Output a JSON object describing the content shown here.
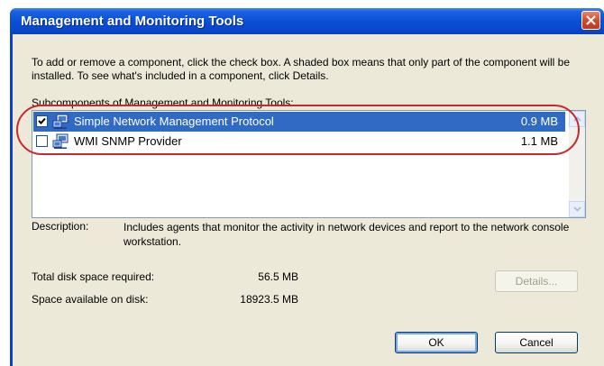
{
  "window": {
    "title": "Management and Monitoring Tools"
  },
  "intro_text": "To add or remove a component, click the check box. A shaded box means that only part of the component will be installed. To see what's included in a component, click Details.",
  "subcomponents_label": "Subcomponents of Management and Monitoring Tools:",
  "components": [
    {
      "name": "Simple Network Management Protocol",
      "size": "0.9 MB",
      "checked": true,
      "selected": true,
      "icon": "computer-network-icon"
    },
    {
      "name": "WMI SNMP Provider",
      "size": "1.1 MB",
      "checked": false,
      "selected": false,
      "icon": "computer-network-icon"
    }
  ],
  "description": {
    "label": "Description:",
    "text": "Includes agents that monitor the activity in network devices and report to the network console workstation."
  },
  "disk": {
    "required_label": "Total disk space required:",
    "required_value": "56.5 MB",
    "available_label": "Space available on disk:",
    "available_value": "18923.5 MB"
  },
  "buttons": {
    "details": "Details...",
    "ok": "OK",
    "cancel": "Cancel"
  },
  "colors": {
    "title_bar": "#0a4fd6",
    "selection": "#316ac5",
    "dialog_bg": "#ece9d8",
    "annotation": "#c62a2a"
  }
}
